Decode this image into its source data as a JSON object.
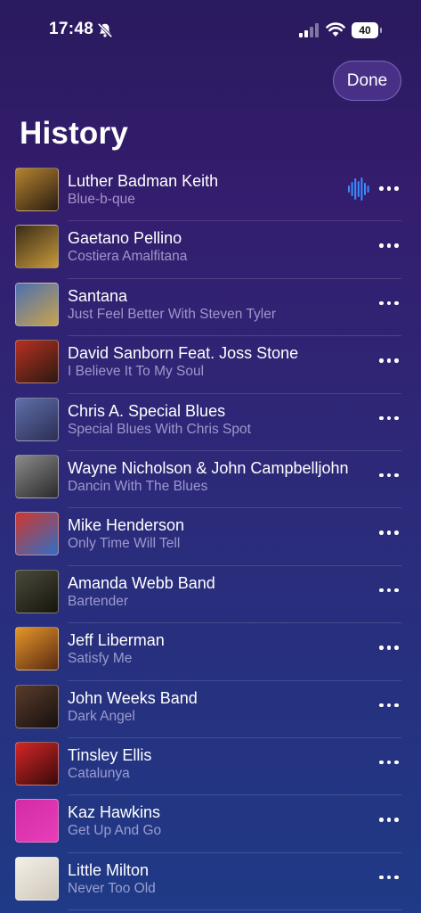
{
  "status": {
    "time": "17:48",
    "battery": "40",
    "icons": [
      "bell-slash-icon",
      "cellular-signal-icon",
      "wifi-icon",
      "battery-icon"
    ]
  },
  "header": {
    "done_label": "Done",
    "title": "History"
  },
  "history": [
    {
      "title": "Luther Badman Keith",
      "subtitle": "Blue-b-que",
      "playing": true,
      "art_colors": [
        "#b5832f",
        "#2a1d12"
      ]
    },
    {
      "title": "Gaetano Pellino",
      "subtitle": "Costiera Amalfitana",
      "art_colors": [
        "#3a2c18",
        "#c79a3b"
      ]
    },
    {
      "title": "Santana",
      "subtitle": "Just Feel Better  With Steven Tyler",
      "art_colors": [
        "#4c6fb1",
        "#c9a44c"
      ]
    },
    {
      "title": "David Sanborn Feat. Joss Stone",
      "subtitle": "I Believe It To My Soul",
      "art_colors": [
        "#b83020",
        "#2a1a12"
      ]
    },
    {
      "title": "Chris A. Special Blues",
      "subtitle": "Special Blues With Chris Spot",
      "art_colors": [
        "#5f6fa8",
        "#2c2e55"
      ]
    },
    {
      "title": "Wayne Nicholson & John Campbelljohn",
      "subtitle": "Dancin With The Blues",
      "art_colors": [
        "#8a8a8a",
        "#2a2a2a"
      ]
    },
    {
      "title": "Mike Henderson",
      "subtitle": "Only Time Will Tell",
      "art_colors": [
        "#d1362c",
        "#2f6fc7"
      ]
    },
    {
      "title": "Amanda Webb Band",
      "subtitle": "Bartender",
      "art_colors": [
        "#4a4a3a",
        "#15150f"
      ]
    },
    {
      "title": "Jeff Liberman",
      "subtitle": "Satisfy Me",
      "art_colors": [
        "#e5962b",
        "#5a2a10"
      ]
    },
    {
      "title": "John Weeks Band",
      "subtitle": "Dark Angel",
      "art_colors": [
        "#5a3b2a",
        "#161010"
      ]
    },
    {
      "title": "Tinsley Ellis",
      "subtitle": "Catalunya",
      "art_colors": [
        "#d42626",
        "#3a0a0a"
      ]
    },
    {
      "title": "Kaz Hawkins",
      "subtitle": "Get Up And Go",
      "art_colors": [
        "#d52aa6",
        "#e63fb8"
      ]
    },
    {
      "title": "Little Milton",
      "subtitle": "Never Too Old",
      "art_colors": [
        "#f2efe8",
        "#cfc7b9"
      ]
    }
  ],
  "colors": {
    "accent_playing": "#3b8cff",
    "background_top": "#2a1a5e",
    "background_bottom": "#1f3a86"
  }
}
